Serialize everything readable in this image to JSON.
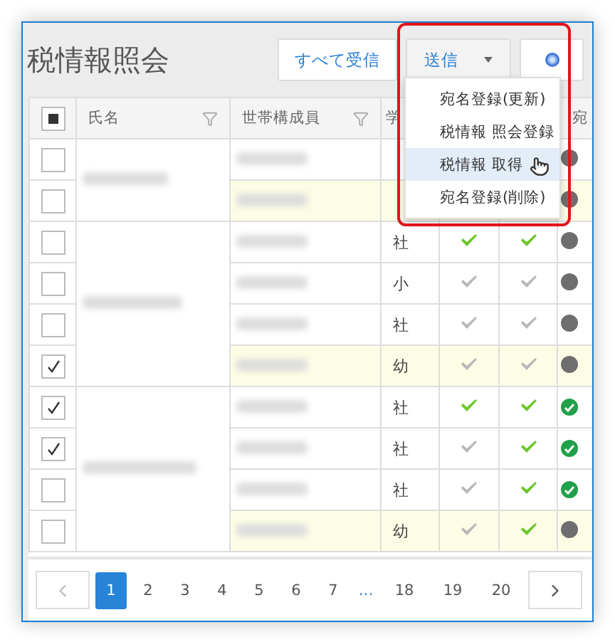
{
  "title": "税情報照会",
  "buttons": [
    {
      "kind": "plain",
      "label": "すべて受信"
    },
    {
      "kind": "dropdown",
      "label": "送信"
    },
    {
      "kind": "help"
    }
  ],
  "send_menu": {
    "open": true,
    "items": [
      {
        "label": "宛名登録(更新)",
        "selected": false
      },
      {
        "label": "税情報 照会登録",
        "selected": false
      },
      {
        "label": "税情報 取得",
        "selected": true
      },
      {
        "label": "宛名登録(削除)",
        "selected": false
      }
    ]
  },
  "table": {
    "header_indeterminate": true,
    "columns": [
      {
        "label": "氏名",
        "kind": "filter"
      },
      {
        "label": "世帯構成員",
        "kind": "filter"
      },
      {
        "label": "学",
        "kind": "plain"
      },
      {
        "label": "宛",
        "kind": "plain"
      }
    ],
    "groups": [
      {
        "rows": [
          {
            "checked": false,
            "highlight": false,
            "registered": false
          },
          {
            "checked": false,
            "highlight": true,
            "registered": false
          }
        ]
      },
      {
        "rows": [
          {
            "checked": false,
            "highlight": false,
            "type": "社",
            "column_5": true,
            "column_6": true,
            "registered": false
          },
          {
            "checked": false,
            "highlight": false,
            "type": "小",
            "column_5": false,
            "column_6": false,
            "registered": false
          },
          {
            "checked": false,
            "highlight": false,
            "type": "社",
            "column_5": false,
            "column_6": false,
            "registered": false
          },
          {
            "checked": true,
            "highlight": true,
            "type": "幼",
            "column_5": false,
            "column_6": false,
            "registered": false
          }
        ]
      },
      {
        "rows": [
          {
            "checked": true,
            "highlight": false,
            "type": "社",
            "column_5": true,
            "column_6": true,
            "registered": true
          },
          {
            "checked": true,
            "highlight": false,
            "type": "社",
            "column_5": false,
            "column_6": true,
            "registered": true
          },
          {
            "checked": false,
            "highlight": false,
            "type": "社",
            "column_5": false,
            "column_6": true,
            "registered": true
          },
          {
            "checked": false,
            "highlight": true,
            "type": "幼",
            "column_5": false,
            "column_6": true,
            "registered": false
          }
        ]
      }
    ]
  },
  "pagination": {
    "pages": [
      {
        "label": "1",
        "selected": true
      },
      {
        "label": "2",
        "selected": false
      },
      {
        "label": "3",
        "selected": false
      },
      {
        "label": "4",
        "selected": false
      },
      {
        "label": "5",
        "selected": false
      },
      {
        "label": "6",
        "selected": false
      },
      {
        "label": "7",
        "selected": false
      },
      {
        "label": "…",
        "selected": false,
        "kind": "gap"
      },
      {
        "label": "18",
        "selected": false
      },
      {
        "label": "19",
        "selected": false
      },
      {
        "label": "20",
        "selected": false
      }
    ]
  }
}
